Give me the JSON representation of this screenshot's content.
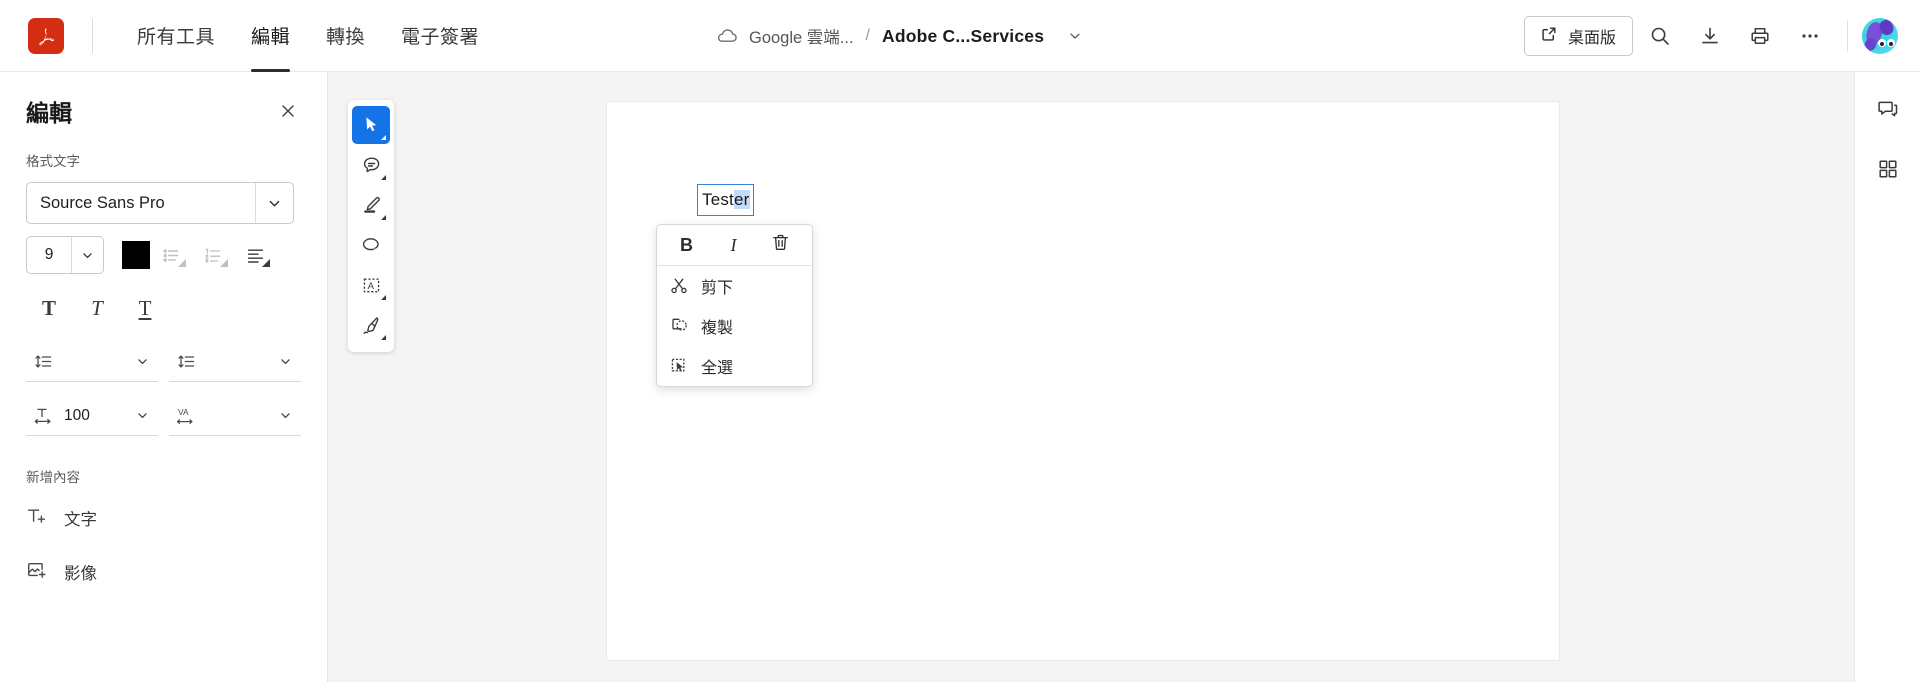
{
  "app": {
    "logo_icon": "adobe-acrobat-logo",
    "brand_color": "#d42e12"
  },
  "topbar": {
    "tabs": [
      {
        "label": "所有工具",
        "name": "all-tools",
        "active": false
      },
      {
        "label": "編輯",
        "name": "edit",
        "active": true
      },
      {
        "label": "轉換",
        "name": "convert",
        "active": false
      },
      {
        "label": "電子簽署",
        "name": "e-sign",
        "active": false
      }
    ],
    "breadcrumb": {
      "cloud_icon": "cloud-icon",
      "source": "Google 雲端...",
      "separator": "/",
      "title": "Adobe C...Services",
      "caret_icon": "chevron-down-icon"
    },
    "desktop_button": {
      "label": "桌面版",
      "icon": "open-external-icon"
    },
    "actions": [
      {
        "name": "search-icon",
        "title": "搜尋"
      },
      {
        "name": "download-icon",
        "title": "下載"
      },
      {
        "name": "print-icon",
        "title": "列印"
      },
      {
        "name": "more-options-icon",
        "title": "更多"
      }
    ],
    "avatar": {
      "name": "user-avatar"
    }
  },
  "left_panel": {
    "title": "編輯",
    "close_icon": "close-icon",
    "format_text_label": "格式文字",
    "font": {
      "value": "Source Sans Pro",
      "caret_icon": "chevron-down-icon"
    },
    "font_size": {
      "value": "9",
      "caret_icon": "chevron-down-icon"
    },
    "text_color": "#000000",
    "list_buttons": [
      {
        "name": "bulleted-list-icon",
        "label": "項目符號清單",
        "disabled": true
      },
      {
        "name": "numbered-list-icon",
        "label": "編號清單",
        "disabled": true
      },
      {
        "name": "text-align-icon",
        "label": "對齊",
        "disabled": false
      }
    ],
    "style_buttons": [
      {
        "name": "bold-icon",
        "label": "粗體",
        "glyph": "T"
      },
      {
        "name": "italic-icon",
        "label": "斜體",
        "glyph": "T"
      },
      {
        "name": "underline-icon",
        "label": "底線",
        "glyph": "T"
      }
    ],
    "spacing": {
      "line_spacing": {
        "icon": "line-spacing-icon",
        "value": "",
        "caret_icon": "chevron-down-icon"
      },
      "paragraph_spacing": {
        "icon": "paragraph-spacing-icon",
        "value": "",
        "caret_icon": "chevron-down-icon"
      },
      "horizontal_scale": {
        "icon": "horizontal-scale-icon",
        "value": "100",
        "caret_icon": "chevron-down-icon"
      },
      "letter_spacing": {
        "icon": "letter-spacing-icon",
        "label": "VA",
        "value": "",
        "caret_icon": "chevron-down-icon"
      }
    },
    "add_content_label": "新增內容",
    "add_items": [
      {
        "name": "add-text",
        "icon": "add-text-icon",
        "label": "文字"
      },
      {
        "name": "add-image",
        "icon": "add-image-icon",
        "label": "影像"
      }
    ]
  },
  "toolrail": {
    "tools": [
      {
        "name": "select-tool",
        "icon": "cursor-arrow-icon",
        "active": true,
        "has_caret": true
      },
      {
        "name": "comment-tool",
        "icon": "comment-bubble-icon",
        "active": false,
        "has_caret": true
      },
      {
        "name": "highlight-tool",
        "icon": "marker-pen-icon",
        "active": false,
        "has_caret": true
      },
      {
        "name": "draw-tool",
        "icon": "lasso-loop-icon",
        "active": false,
        "has_caret": false
      },
      {
        "name": "text-box-tool",
        "icon": "text-box-icon",
        "active": false,
        "has_caret": true
      },
      {
        "name": "signature-tool",
        "icon": "fountain-pen-icon",
        "active": false,
        "has_caret": true
      }
    ]
  },
  "document": {
    "text_box": {
      "text_before": "Test",
      "text_selected": "er",
      "full_text": "Tester"
    }
  },
  "context_menu": {
    "format_buttons": [
      {
        "name": "bold-button",
        "label": "B",
        "title": "粗體"
      },
      {
        "name": "italic-button",
        "label": "I",
        "title": "斜體"
      },
      {
        "name": "delete-button",
        "icon": "trash-icon",
        "title": "刪除"
      }
    ],
    "items": [
      {
        "name": "cut-item",
        "icon": "scissors-icon",
        "label": "剪下"
      },
      {
        "name": "copy-item",
        "icon": "copy-icon",
        "label": "複製"
      },
      {
        "name": "select-all-item",
        "icon": "select-all-icon",
        "label": "全選"
      }
    ]
  },
  "right_rail": {
    "icons": [
      {
        "name": "comments-panel-icon",
        "title": "註解"
      },
      {
        "name": "all-tools-grid-icon",
        "title": "所有工具"
      }
    ]
  }
}
